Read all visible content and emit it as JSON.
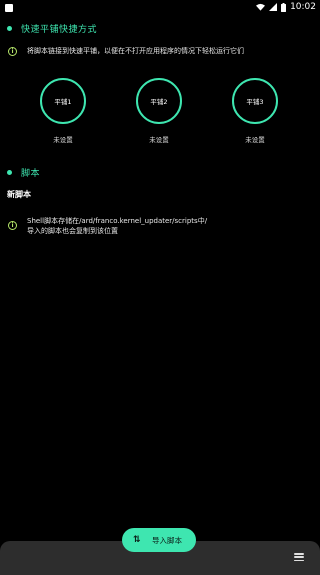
{
  "status_bar": {
    "time": "10:02"
  },
  "quick_tiles_section": {
    "title": "快速平铺快捷方式",
    "info": "将脚本链接到快速平铺，以便在不打开应用程序的情况下轻松运行它们",
    "tiles": [
      {
        "label": "平铺1",
        "status": "未设置"
      },
      {
        "label": "平铺2",
        "status": "未设置"
      },
      {
        "label": "平铺3",
        "status": "未设置"
      }
    ]
  },
  "scripts_section": {
    "title": "脚本",
    "new_script": "新脚本",
    "info_line1": "Shell脚本存储在/ard/franco.kernel_updater/scripts中/",
    "info_line2": "导入的脚本也会复制到该位置"
  },
  "fab": {
    "label": "导入脚本",
    "icon": "sort-arrows-icon"
  },
  "colors": {
    "accent": "#3ee6b0",
    "info_icon": "#b7e86b",
    "bottom_bar": "#2d2d2d"
  }
}
